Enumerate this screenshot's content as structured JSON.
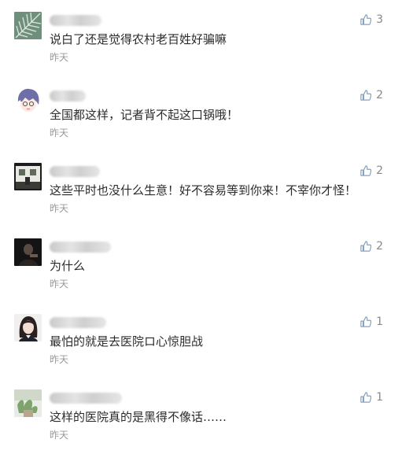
{
  "colors": {
    "text": "#2b2b2b",
    "muted": "#9a9a9a",
    "like_icon": "#8aa3b8",
    "background": "#ffffff"
  },
  "comments": [
    {
      "text": "说白了还是觉得农村老百姓好骗嘛",
      "time": "昨天",
      "likes": "3",
      "avatar": "palm-leaf-avatar"
    },
    {
      "text": "全国都这样，记者背不起这口锅哦！",
      "time": "昨天",
      "likes": "2",
      "avatar": "anime-girl-avatar"
    },
    {
      "text": "这些平时也没什么生意！好不容易等到你来！不宰你才怪！",
      "time": "昨天",
      "likes": "2",
      "avatar": "building-photo-avatar"
    },
    {
      "text": "为什么",
      "time": "昨天",
      "likes": "2",
      "avatar": "dark-portrait-avatar"
    },
    {
      "text": "最怕的就是去医院ロ心惊胆战",
      "time": "昨天",
      "likes": "1",
      "avatar": "girl-portrait-avatar"
    },
    {
      "text": "这样的医院真的是黑得不像话……",
      "time": "昨天",
      "likes": "1",
      "avatar": "plant-photo-avatar"
    }
  ]
}
